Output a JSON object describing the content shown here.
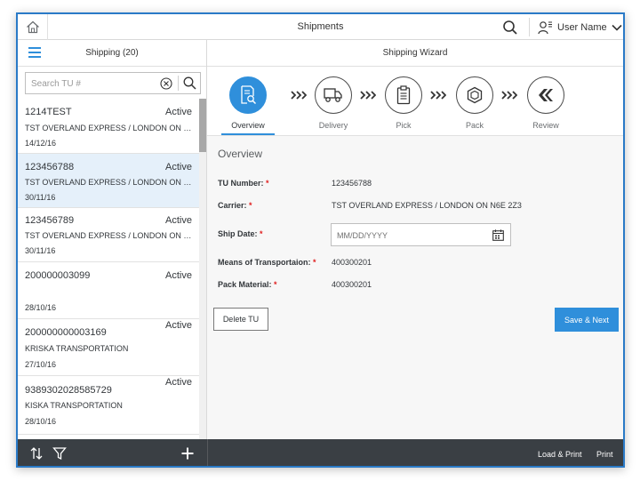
{
  "shell": {
    "title": "Shipments",
    "user_name": "User Name",
    "icons": {
      "home": "home-icon",
      "search": "search-icon",
      "user": "user-icon",
      "chevron": "chevron-down-icon"
    }
  },
  "master": {
    "title": "Shipping (20)",
    "search_placeholder": "Search TU #",
    "items": [
      {
        "id": "1214TEST",
        "status": "Active",
        "carrier": "TST OVERLAND EXPRESS / LONDON ON N6E 2Z3",
        "date": "14/12/16",
        "selected": false
      },
      {
        "id": "123456788",
        "status": "Active",
        "carrier": "TST OVERLAND EXPRESS / LONDON ON N6E 2Z3",
        "date": "30/11/16",
        "selected": true
      },
      {
        "id": "123456789",
        "status": "Active",
        "carrier": "TST OVERLAND EXPRESS / LONDON ON N6E 2Z3",
        "date": "30/11/16",
        "selected": false
      },
      {
        "id": "200000003099",
        "status": "Active",
        "carrier": "",
        "date": "28/10/16",
        "selected": false
      },
      {
        "id": "200000000003169",
        "status": "Active",
        "carrier": "KRISKA TRANSPORTATION",
        "date": "27/10/16",
        "selected": false
      },
      {
        "id": "9389302028585729",
        "status": "Active",
        "carrier": "KISKA TRANSPORTATION",
        "date": "28/10/16",
        "selected": false
      }
    ]
  },
  "detail": {
    "title": "Shipping Wizard",
    "steps": [
      {
        "label": "Overview",
        "icon": "document-search-icon",
        "active": true
      },
      {
        "label": "Delivery",
        "icon": "truck-icon",
        "active": false
      },
      {
        "label": "Pick",
        "icon": "clipboard-icon",
        "active": false
      },
      {
        "label": "Pack",
        "icon": "package-icon",
        "active": false
      },
      {
        "label": "Review",
        "icon": "review-icon",
        "active": false
      }
    ],
    "form": {
      "section_title": "Overview",
      "tu_number_label": "TU Number:",
      "tu_number_value": "123456788",
      "carrier_label": "Carrier:",
      "carrier_value": "TST OVERLAND EXPRESS / LONDON ON N6E 2Z3",
      "ship_date_label": "Ship Date:",
      "ship_date_placeholder": "MM/DD/YYYY",
      "means_label": "Means of Transportaion:",
      "means_value": "400300201",
      "pack_label": "Pack Material:",
      "pack_value": "400300201",
      "required_marker": "*"
    },
    "delete_label": "Delete TU",
    "save_label": "Save & Next"
  },
  "footer": {
    "load_print_label": "Load & Print",
    "print_label": "Print",
    "icons": {
      "sort": "sort-icon",
      "filter": "filter-icon",
      "add": "add-icon"
    }
  },
  "colors": {
    "accent": "#2f8fdb",
    "frame": "#2a7ac7",
    "footer": "#3a3f44",
    "selected": "#e5f0fa",
    "required": "#e01e1e"
  }
}
